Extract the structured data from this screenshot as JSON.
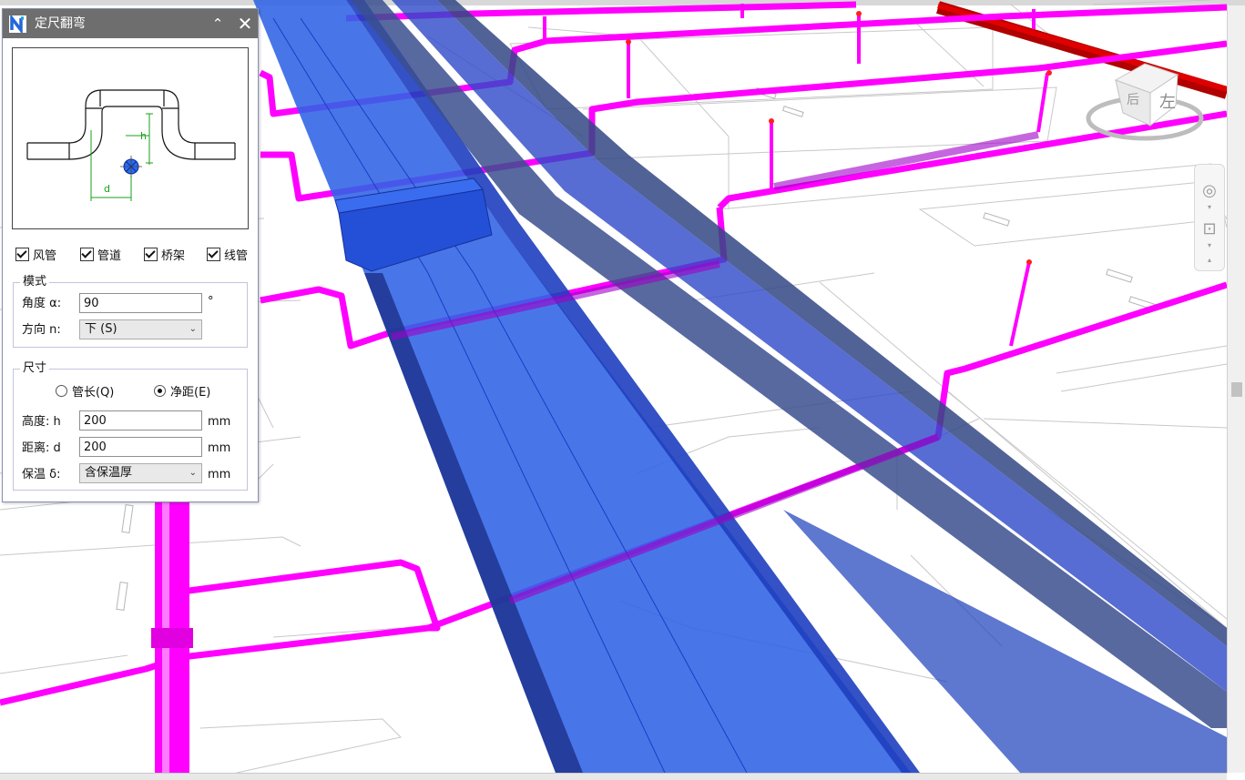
{
  "dialog": {
    "title": "定尺翻弯",
    "collapse_glyph": "⌃",
    "close_glyph": "✕",
    "preview": {
      "label_h": "h",
      "label_d": "d"
    },
    "categories": [
      {
        "label": "风管",
        "checked": true
      },
      {
        "label": "管道",
        "checked": true
      },
      {
        "label": "桥架",
        "checked": true
      },
      {
        "label": "线管",
        "checked": true
      }
    ],
    "mode": {
      "legend": "模式",
      "angle_label": "角度 α:",
      "angle_value": "90",
      "angle_unit": "°",
      "direction_label": "方向 n:",
      "direction_value": "下 (S)"
    },
    "size": {
      "legend": "尺寸",
      "radio_length": "管长(Q)",
      "radio_clearance": "净距(E)",
      "selected": "净距(E)",
      "height_label": "高度: h",
      "height_value": "200",
      "height_unit": "mm",
      "distance_label": "距离: d",
      "distance_value": "200",
      "distance_unit": "mm",
      "insulation_label": "保温 δ:",
      "insulation_value": "含保温厚",
      "insulation_unit": "mm"
    }
  },
  "viewcube": {
    "face_label": "左",
    "side_label": "后"
  },
  "colors": {
    "duct_blue": "#2b59e8",
    "pipe_magenta": "#ff10ff",
    "red_pipe": "#d40000",
    "title_bar": "#6e6e6e"
  }
}
